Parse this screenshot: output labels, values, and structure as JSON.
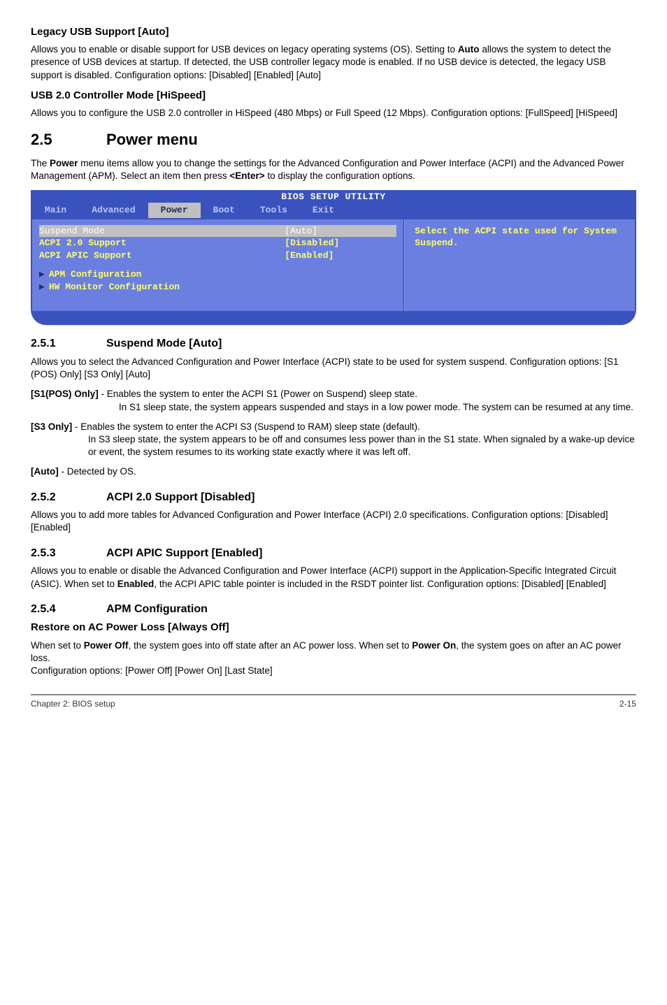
{
  "s_legacy_title": "Legacy USB Support [Auto]",
  "s_legacy_body": "Allows you to enable or disable support for USB devices on legacy operating systems (OS). Setting to ",
  "s_legacy_bold": "Auto",
  "s_legacy_body2": " allows the system to detect the presence of USB devices at startup. If detected, the USB controller legacy mode is enabled. If no USB device is detected, the legacy USB support is disabled. Configuration options: [Disabled] [Enabled] [Auto]",
  "s_usb20_title": "USB 2.0 Controller Mode [HiSpeed]",
  "s_usb20_body": "Allows you to configure the USB 2.0 controller in HiSpeed (480 Mbps) or Full Speed (12 Mbps). Configuration options: [FullSpeed] [HiSpeed]",
  "s25_num": "2.5",
  "s25_title": "Power menu",
  "s25_body1": "The ",
  "s25_bold": "Power",
  "s25_body2": " menu items allow you to change the settings for the Advanced Configuration and Power Interface (ACPI) and the Advanced Power Management (APM). Select an item then press ",
  "s25_bold2": "<Enter>",
  "s25_body3": " to display the configuration options.",
  "bios": {
    "title": "BIOS SETUP UTILITY",
    "menu": [
      "Main",
      "Advanced",
      "Power",
      "Boot",
      "Tools",
      "Exit"
    ],
    "lines": [
      {
        "label": "Suspend Mode",
        "val": "[Auto]",
        "hl": true
      },
      {
        "label": "ACPI 2.0 Support",
        "val": "[Disabled]",
        "hl": false
      },
      {
        "label": "ACPI APIC Support",
        "val": "[Enabled]",
        "hl": false
      }
    ],
    "configs": [
      "APM Configuration",
      "HW Monitor Configuration"
    ],
    "help": "Select the ACPI state used for System Suspend."
  },
  "s251_num": "2.5.1",
  "s251_title": "Suspend Mode [Auto]",
  "s251_body": "Allows you to select the Advanced Configuration and Power Interface (ACPI) state to be used for system suspend. Configuration options: [S1 (POS) Only] [S3 Only] [Auto]",
  "s251_s1_label": "[S1(POS) Only]",
  "s251_s1_body": " - Enables the system to enter the ACPI S1 (Power on Suspend) sleep state. In S1 sleep state, the system appears suspended and stays in a low power mode. The system can be resumed at any time.",
  "s251_s3_label": "[S3 Only]",
  "s251_s3_body": " - Enables the system to enter the ACPI S3 (Suspend to RAM) sleep state (default). In S3 sleep state, the system appears to be off and consumes less power than in the S1 state. When signaled by a wake-up device or event, the system resumes to its working state exactly where it was left off.",
  "s251_auto_label": "[Auto]",
  "s251_auto_body": " - Detected by OS.",
  "s252_num": "2.5.2",
  "s252_title": "ACPI 2.0 Support [Disabled]",
  "s252_body": "Allows you to add more tables for Advanced Configuration and Power Interface (ACPI) 2.0 specifications. Configuration options: [Disabled] [Enabled]",
  "s253_num": "2.5.3",
  "s253_title": "ACPI APIC Support [Enabled]",
  "s253_body1": "Allows you to enable or disable the Advanced Configuration and Power Interface (ACPI) support in the Application-Specific Integrated Circuit (ASIC). When set to ",
  "s253_bold": "Enabled",
  "s253_body2": ", the ACPI APIC table pointer is included in the RSDT pointer list. Configuration options: [Disabled] [Enabled]",
  "s254_num": "2.5.4",
  "s254_title": "APM Configuration",
  "s254r_title": "Restore on AC Power Loss [Always Off]",
  "s254r_body1": "When set to ",
  "s254r_bold1": "Power Off",
  "s254r_body2": ", the system goes into off state after an AC power loss. When set to ",
  "s254r_bold2": "Power On",
  "s254r_body3": ", the system goes on after an AC power loss.",
  "s254r_body4": "Configuration options: [Power Off] [Power On] [Last State]",
  "footer_left": "Chapter 2: BIOS setup",
  "footer_right": "2-15"
}
